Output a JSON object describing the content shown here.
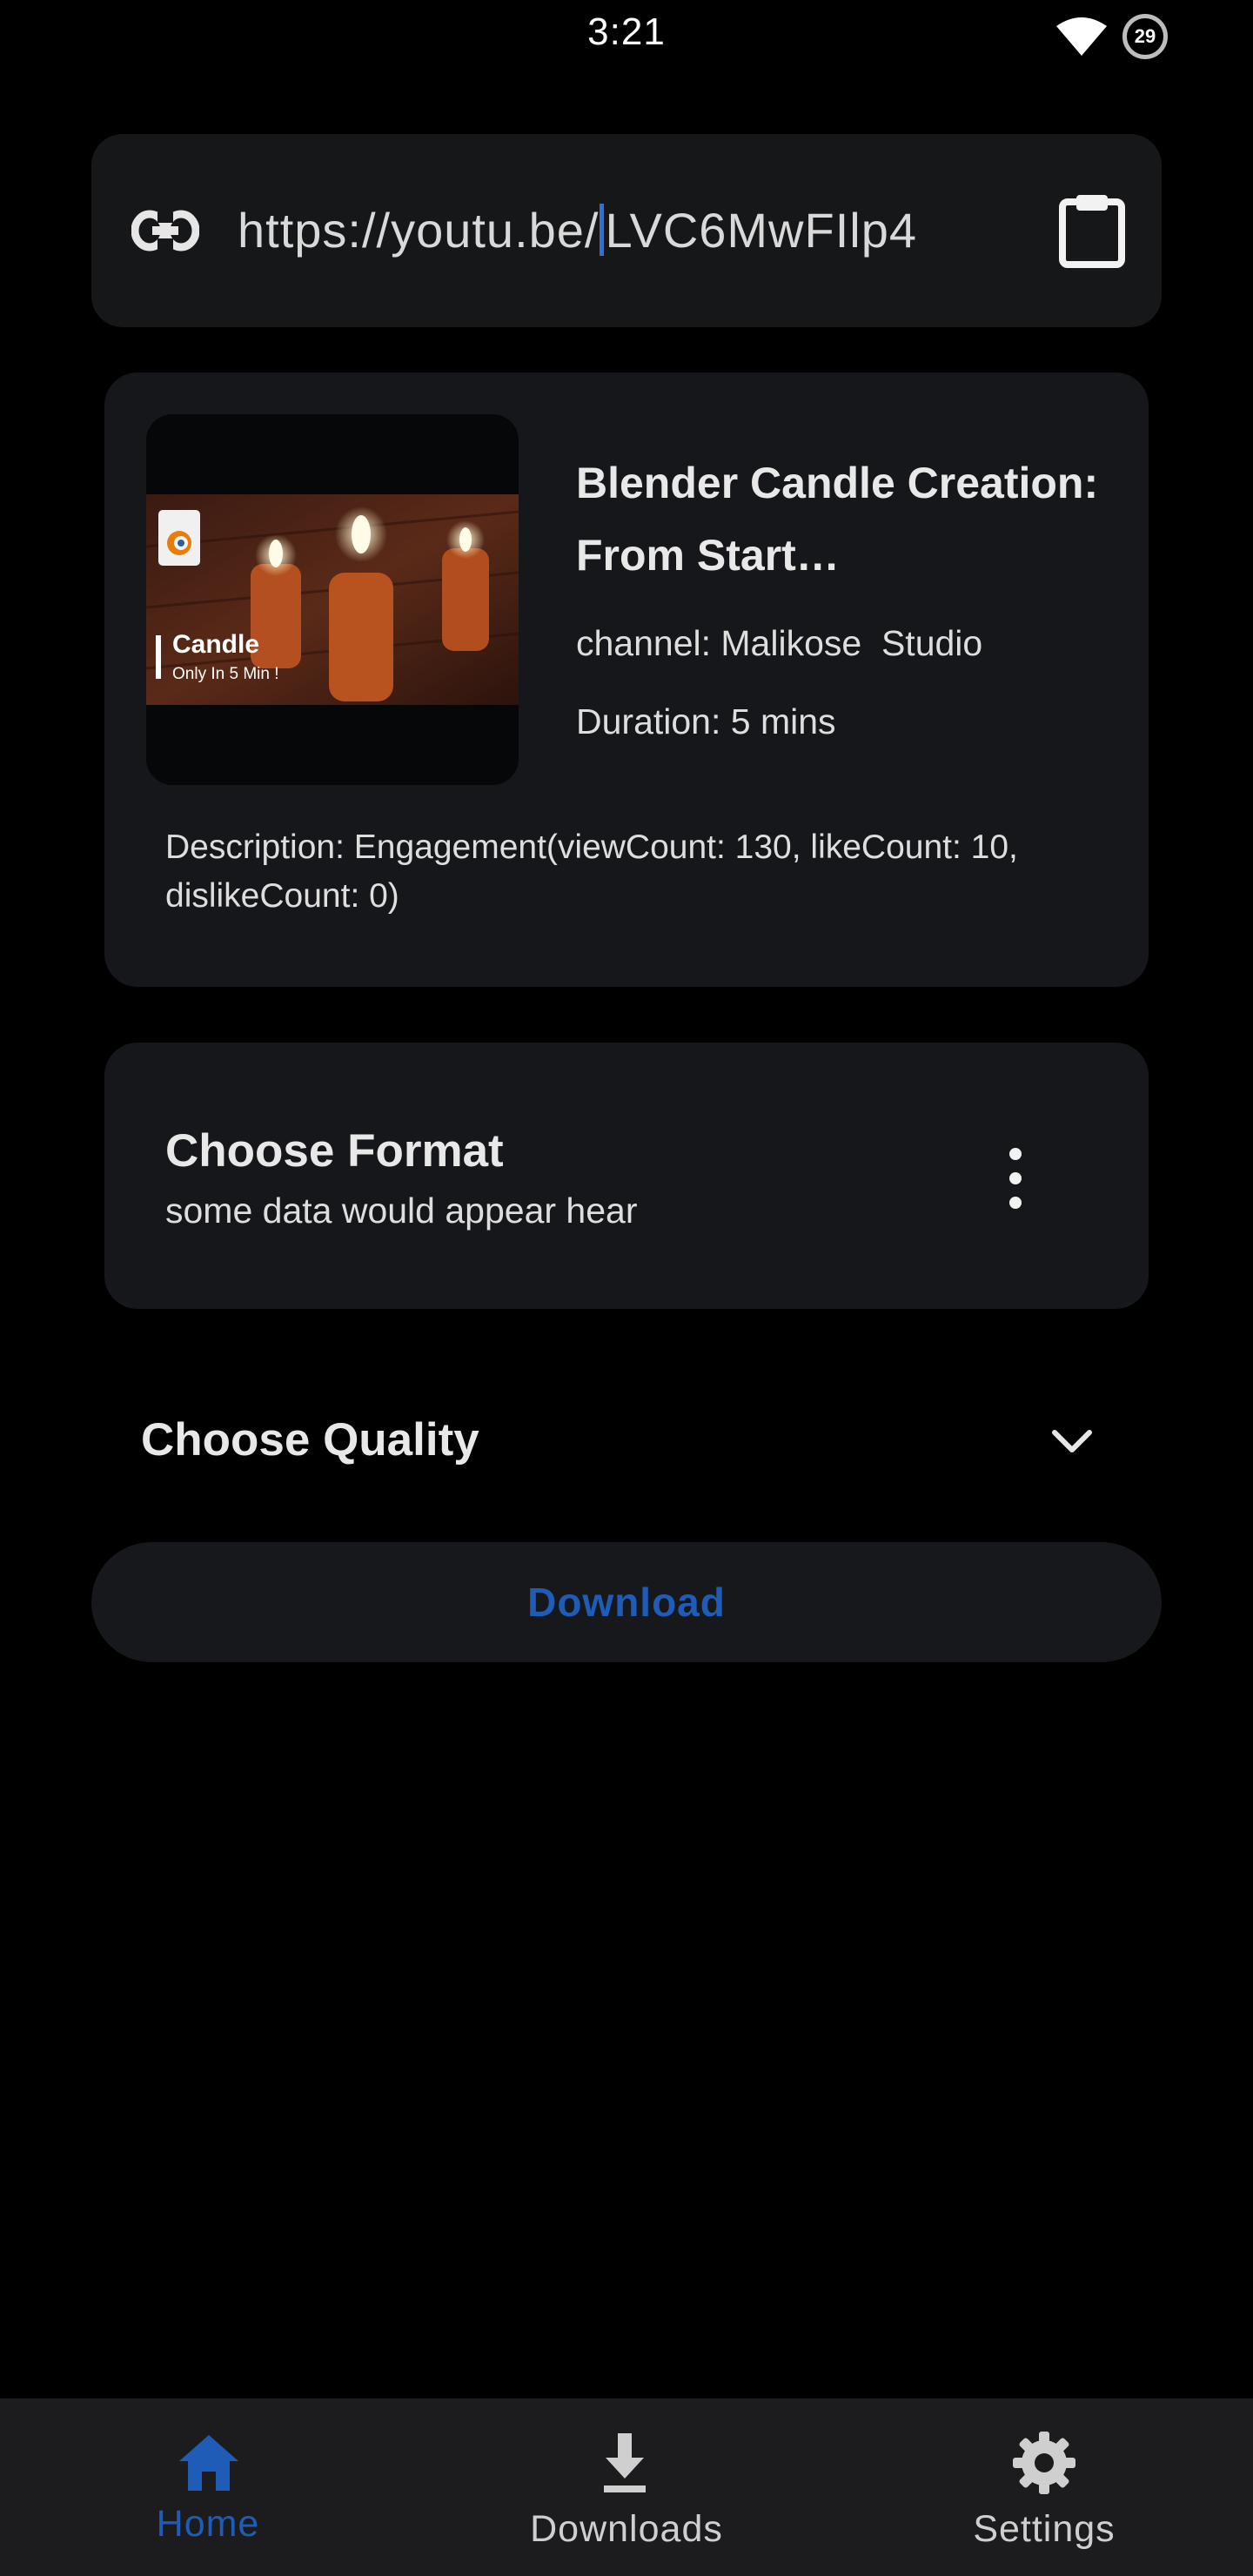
{
  "status_bar": {
    "time": "3:21",
    "battery": "29",
    "icons": [
      "wifi-icon",
      "battery-icon"
    ]
  },
  "url_bar": {
    "value_before_caret": "https://youtu.be/",
    "value_after_caret": "LVC6MwFIlp4",
    "icons": [
      "link-icon",
      "clipboard-icon"
    ]
  },
  "video": {
    "title": "Blender Candle Creation: From Start…",
    "channel": "channel: Malikose  Studio",
    "duration": "Duration: 5 mins",
    "description": "Description: Engagement(viewCount: 130, likeCount: 10, dislikeCount: 0)",
    "thumbnail": {
      "caption_title": "Candle",
      "caption_sub": "Only In 5 Min !",
      "badge_text": "blender"
    }
  },
  "format": {
    "title": "Choose Format",
    "subtitle": "some data would appear hear",
    "menu_icon": "more-vert-icon"
  },
  "quality": {
    "label": "Choose Quality",
    "icon": "chevron-down-icon"
  },
  "download": {
    "label": "Download"
  },
  "bottom_nav": {
    "active": "home",
    "items": [
      {
        "label": "Home",
        "icon": "home-icon"
      },
      {
        "label": "Downloads",
        "icon": "download-icon"
      },
      {
        "label": "Settings",
        "icon": "gear-icon"
      }
    ]
  },
  "colors": {
    "background": "#000000",
    "card": "#16171a",
    "accent": "#1e5cb8",
    "caret": "#2f6fd8",
    "nav_bar": "#1c1c1f"
  }
}
